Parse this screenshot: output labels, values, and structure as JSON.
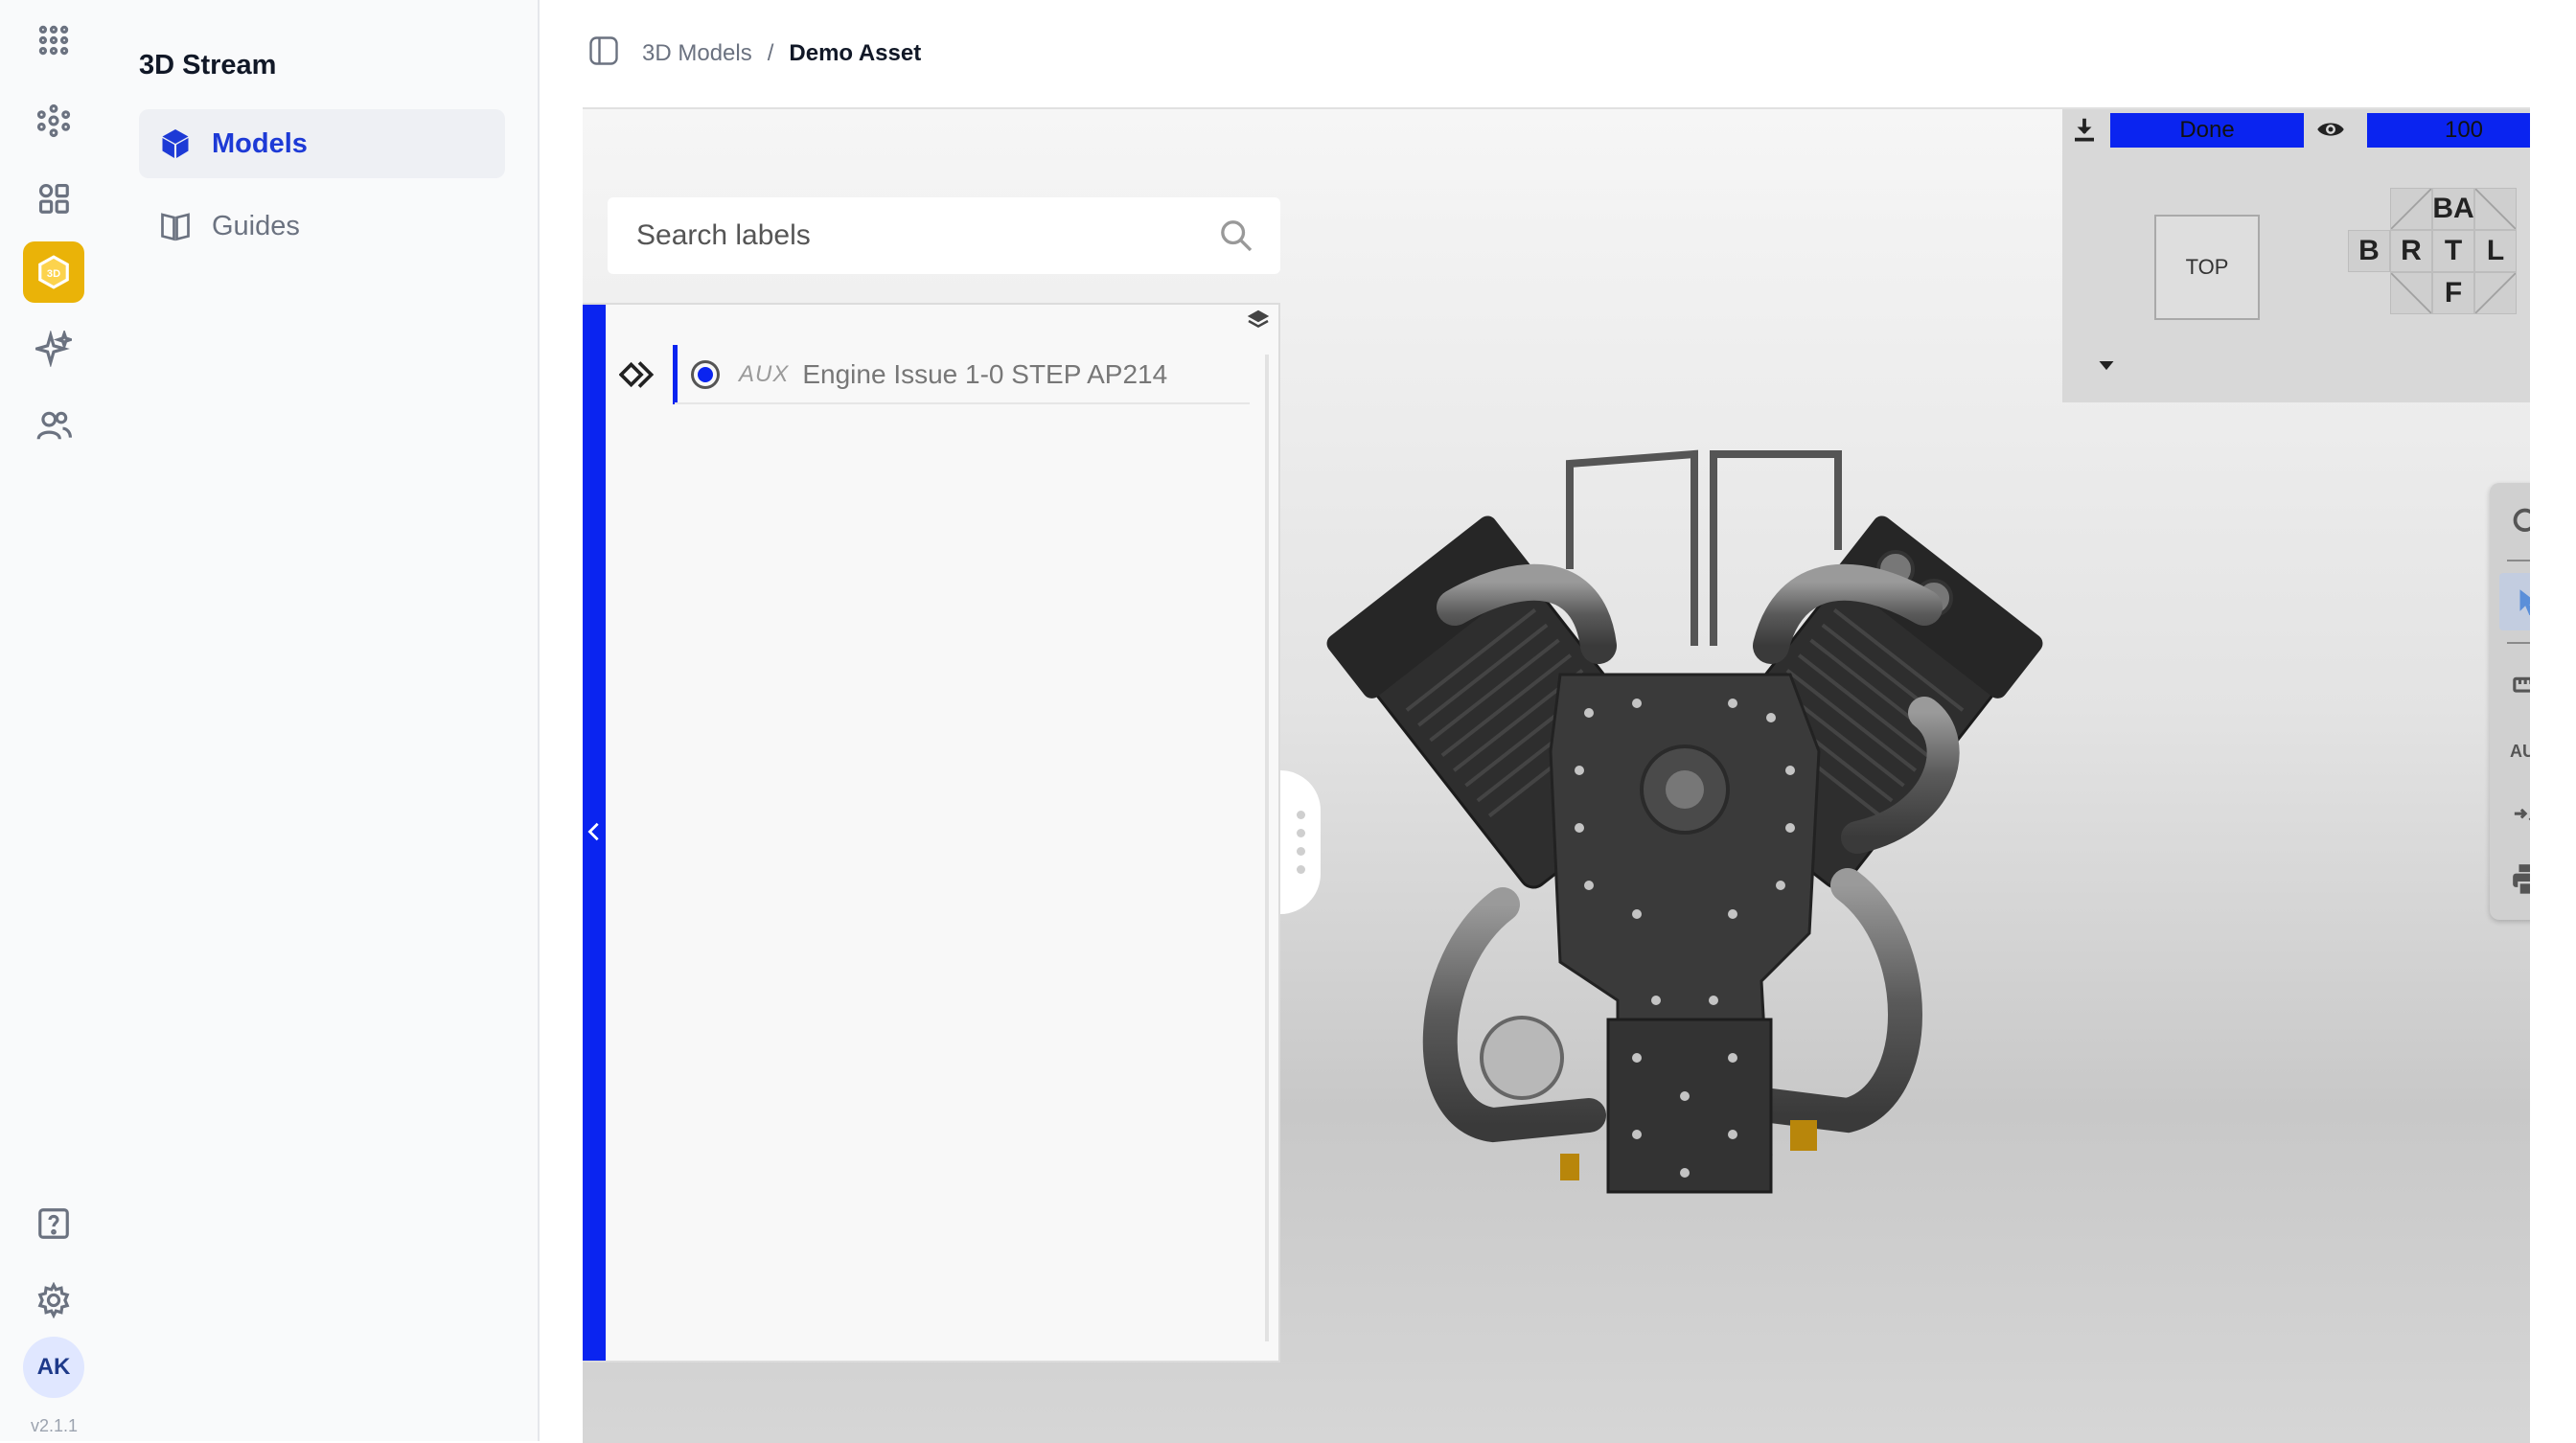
{
  "app": {
    "title": "3D Stream",
    "version": "v2.1.1",
    "user_initials": "AK"
  },
  "rail": {
    "icons": [
      "apps-grid-icon",
      "network-icon",
      "modules-icon",
      "3d-icon",
      "sparkles-icon",
      "users-icon"
    ],
    "active": "3d-icon",
    "badge_3d": "3D",
    "bottom_icons": [
      "help-icon",
      "gear-icon"
    ]
  },
  "nav": {
    "items": [
      {
        "label": "Models",
        "icon": "cube-icon",
        "active": true
      },
      {
        "label": "Guides",
        "icon": "book-icon",
        "active": false
      }
    ]
  },
  "breadcrumb": {
    "items": [
      "3D Models",
      "Demo Asset"
    ],
    "separator": "/"
  },
  "viewer": {
    "search_placeholder": "Search labels",
    "labels": [
      {
        "tag": "AUX",
        "name": "Engine Issue 1-0 STEP AP214",
        "selected": true
      }
    ],
    "status": "Done",
    "opacity": "100",
    "view_cube": {
      "top_label": "TOP",
      "faces": {
        "back": "BA",
        "bottom": "B",
        "right": "R",
        "top": "T",
        "left": "L",
        "front": "F"
      }
    },
    "tools": [
      {
        "name": "zoom-tool",
        "icon": "magnifier-icon"
      },
      {
        "name": "select-tool",
        "icon": "pointer-icon",
        "active": true
      },
      {
        "name": "measure-tool",
        "icon": "ruler-icon"
      },
      {
        "name": "aux-tool",
        "label": "AUX"
      },
      {
        "name": "explode-tool",
        "icon": "compress-icon"
      },
      {
        "name": "print-tool",
        "icon": "printer-icon"
      }
    ]
  },
  "colors": {
    "accent_blue": "#0a24f0",
    "nav_active_text": "#1d3ad6",
    "rail_active": "#eab308"
  }
}
